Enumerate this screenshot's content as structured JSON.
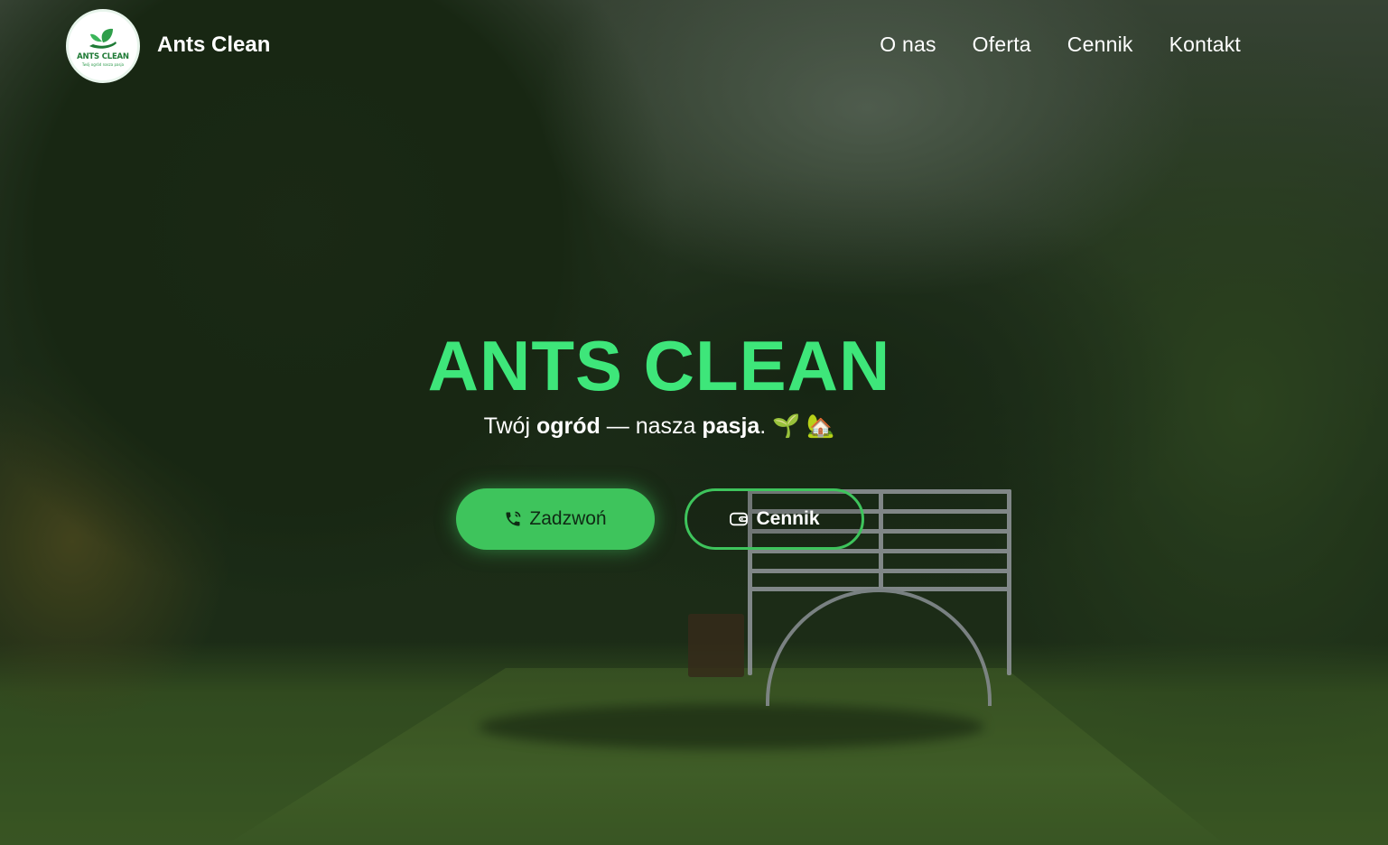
{
  "header": {
    "logo_text": "ANTS CLEAN",
    "logo_slogan": "Twój ogród nasza pasja",
    "brand_name": "Ants Clean",
    "nav": [
      {
        "label": "O nas"
      },
      {
        "label": "Oferta"
      },
      {
        "label": "Cennik"
      },
      {
        "label": "Kontakt"
      }
    ]
  },
  "hero": {
    "title": "ANTS CLEAN",
    "tagline": {
      "part1": "Twój ",
      "bold1": "ogród",
      "part2": " — nasza ",
      "bold2": "pasja",
      "part3": ". 🌱 🏡"
    },
    "buttons": {
      "call": {
        "label": "Zadzwoń",
        "icon": "phone-icon"
      },
      "price": {
        "label": "Cennik",
        "icon": "wallet-icon"
      }
    }
  },
  "colors": {
    "accent": "#3ee67a",
    "button": "#3ec45c",
    "text": "#ffffff"
  }
}
